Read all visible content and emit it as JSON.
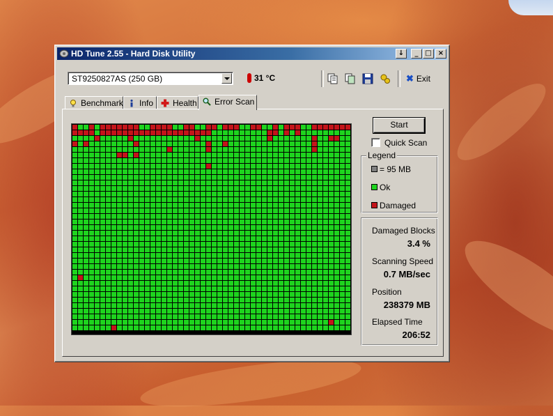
{
  "window": {
    "title": "HD Tune 2.55 - Hard Disk Utility"
  },
  "titlebar_buttons": [
    "↓",
    "_",
    "□",
    "×"
  ],
  "drive": {
    "selected": "ST9250827AS (250 GB)"
  },
  "temperature": "31 °C",
  "exit_label": "Exit",
  "tabs": [
    {
      "label": "Benchmark",
      "icon": "lightbulb-icon"
    },
    {
      "label": "Info",
      "icon": "info-icon"
    },
    {
      "label": "Health",
      "icon": "health-cross-icon"
    },
    {
      "label": "Error Scan",
      "icon": "magnifier-icon",
      "active": true
    }
  ],
  "scan": {
    "start_label": "Start",
    "quick_scan_label": "Quick Scan",
    "quick_scan_checked": false
  },
  "legend": {
    "title": "Legend",
    "block": "= 95 MB",
    "ok": "Ok",
    "damaged": "Damaged"
  },
  "stats": {
    "damaged_blocks_label": "Damaged Blocks",
    "damaged_blocks_value": "3.4 %",
    "speed_label": "Scanning Speed",
    "speed_value": "0.7 MB/sec",
    "position_label": "Position",
    "position_value": "238379 MB",
    "elapsed_label": "Elapsed Time",
    "elapsed_value": "206:52"
  },
  "colors": {
    "ok": "#1ed41e",
    "damaged": "#c4141a",
    "title_bar": "#0a246a"
  },
  "block_map": {
    "columns": 50,
    "rows": 37,
    "damaged_cells": [
      [
        0,
        0
      ],
      [
        0,
        3
      ],
      [
        0,
        5
      ],
      [
        0,
        6
      ],
      [
        0,
        7
      ],
      [
        0,
        8
      ],
      [
        0,
        9
      ],
      [
        0,
        10
      ],
      [
        0,
        11
      ],
      [
        0,
        14
      ],
      [
        0,
        15
      ],
      [
        0,
        16
      ],
      [
        0,
        17
      ],
      [
        0,
        20
      ],
      [
        0,
        21
      ],
      [
        0,
        24
      ],
      [
        0,
        25
      ],
      [
        0,
        27
      ],
      [
        0,
        28
      ],
      [
        0,
        29
      ],
      [
        0,
        32
      ],
      [
        0,
        33
      ],
      [
        0,
        36
      ],
      [
        0,
        38
      ],
      [
        0,
        39
      ],
      [
        0,
        40
      ],
      [
        0,
        43
      ],
      [
        0,
        44
      ],
      [
        0,
        45
      ],
      [
        0,
        46
      ],
      [
        0,
        47
      ],
      [
        0,
        48
      ],
      [
        0,
        49
      ],
      [
        1,
        0
      ],
      [
        1,
        1
      ],
      [
        1,
        2
      ],
      [
        1,
        3
      ],
      [
        1,
        5
      ],
      [
        1,
        6
      ],
      [
        1,
        7
      ],
      [
        1,
        8
      ],
      [
        1,
        9
      ],
      [
        1,
        10
      ],
      [
        1,
        11
      ],
      [
        1,
        12
      ],
      [
        1,
        13
      ],
      [
        1,
        14
      ],
      [
        1,
        15
      ],
      [
        1,
        16
      ],
      [
        1,
        17
      ],
      [
        1,
        18
      ],
      [
        1,
        19
      ],
      [
        1,
        20
      ],
      [
        1,
        21
      ],
      [
        1,
        22
      ],
      [
        1,
        23
      ],
      [
        1,
        24
      ],
      [
        1,
        35
      ],
      [
        1,
        36
      ],
      [
        1,
        38
      ],
      [
        1,
        40
      ],
      [
        2,
        4
      ],
      [
        2,
        10
      ],
      [
        2,
        22
      ],
      [
        2,
        35
      ],
      [
        2,
        43
      ],
      [
        2,
        46
      ],
      [
        2,
        47
      ],
      [
        3,
        0
      ],
      [
        3,
        2
      ],
      [
        3,
        11
      ],
      [
        3,
        24
      ],
      [
        3,
        27
      ],
      [
        3,
        43
      ],
      [
        4,
        17
      ],
      [
        4,
        24
      ],
      [
        4,
        43
      ],
      [
        5,
        8
      ],
      [
        5,
        9
      ],
      [
        5,
        11
      ],
      [
        7,
        24
      ],
      [
        27,
        1
      ],
      [
        35,
        46
      ],
      [
        36,
        7
      ]
    ]
  }
}
